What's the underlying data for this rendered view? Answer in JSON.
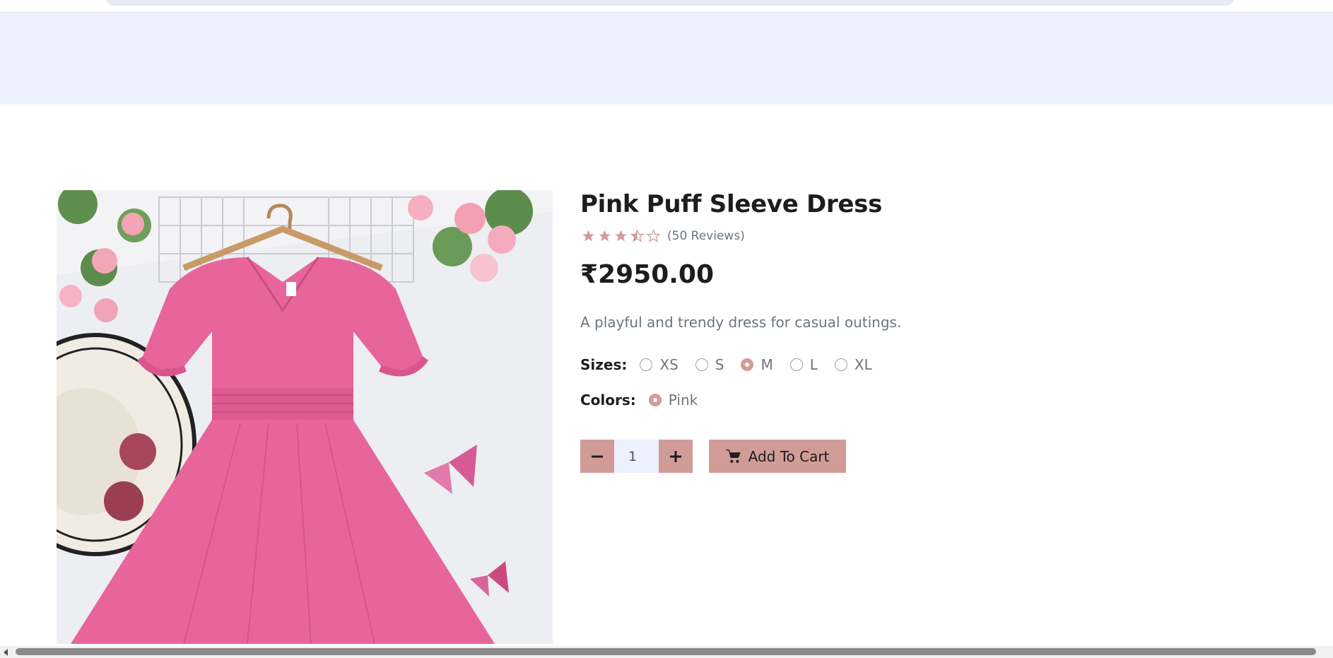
{
  "product": {
    "title": "Pink Puff Sleeve Dress",
    "rating": 3.5,
    "rating_max": 5,
    "reviews_label": "(50 Reviews)",
    "price": "₹2950.00",
    "description": "A playful and trendy dress for casual outings.",
    "image_alt": "Pink puff sleeve dress on a hanger"
  },
  "options": {
    "sizes_label": "Sizes:",
    "sizes": [
      {
        "label": "XS",
        "checked": false
      },
      {
        "label": "S",
        "checked": false
      },
      {
        "label": "M",
        "checked": true
      },
      {
        "label": "L",
        "checked": false
      },
      {
        "label": "XL",
        "checked": false
      }
    ],
    "colors_label": "Colors:",
    "colors": [
      {
        "label": "Pink",
        "checked": true
      }
    ]
  },
  "cart": {
    "quantity": "1",
    "add_label": "Add To Cart"
  },
  "icons": {
    "minus": "minus-icon",
    "plus": "plus-icon",
    "cart": "cart-icon",
    "star": "star-icon"
  },
  "colors": {
    "accent": "#d19c97",
    "header_band": "#edf1ff",
    "dress": "#e8659b"
  }
}
